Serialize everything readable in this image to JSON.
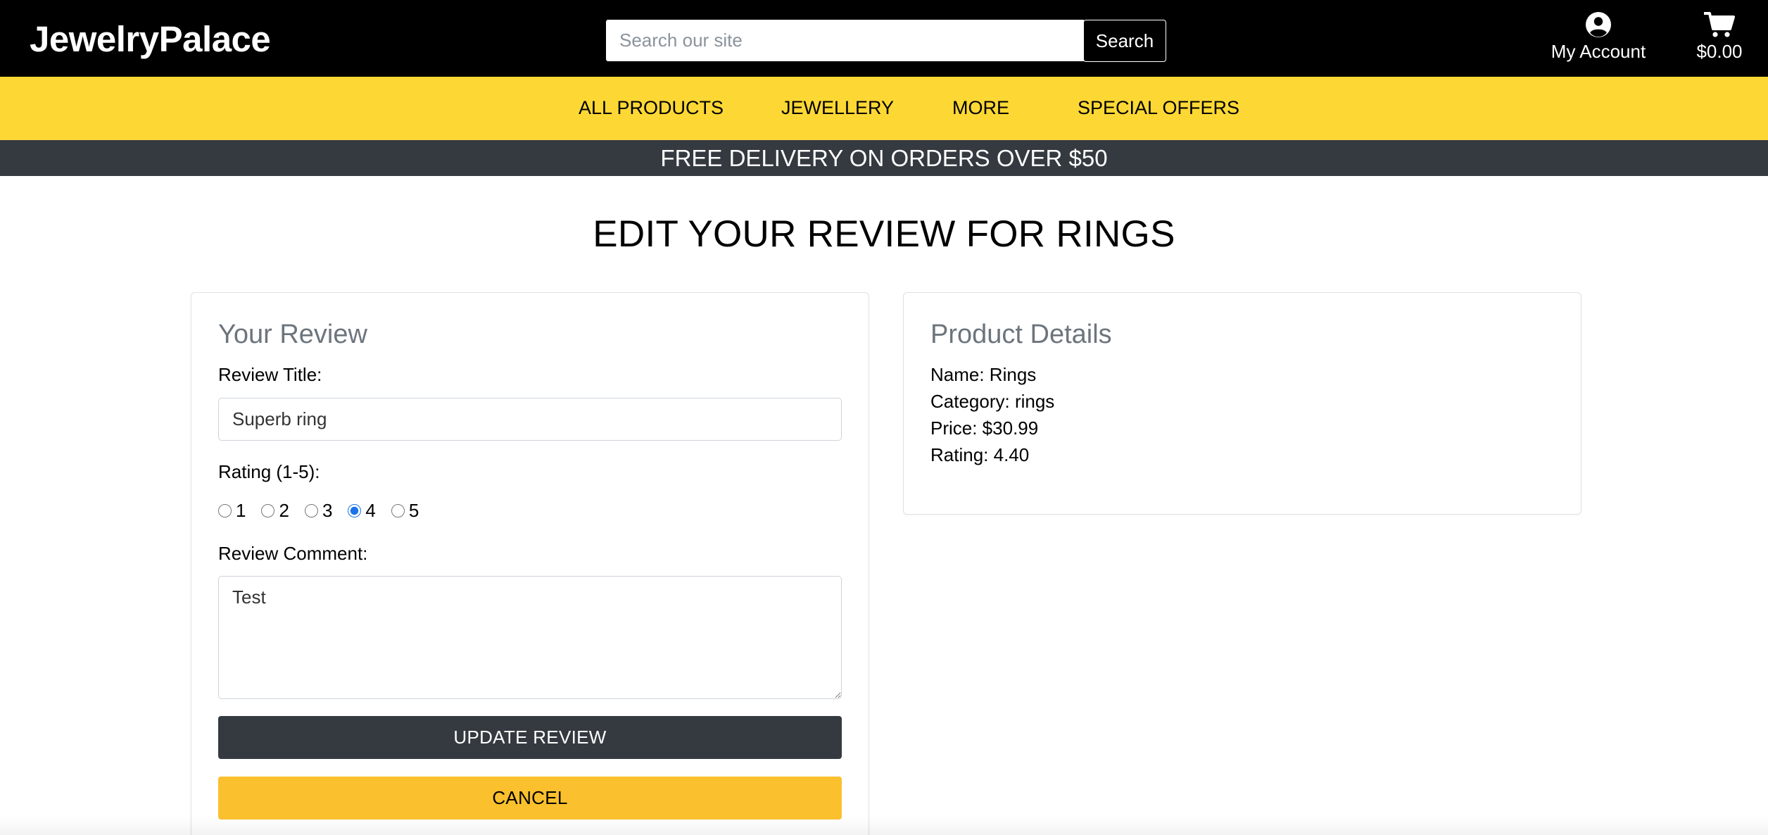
{
  "header": {
    "logo": "JewelryPalace",
    "search_placeholder": "Search our site",
    "search_button": "Search",
    "account_label": "My Account",
    "account_icon": "user-circle-icon",
    "cart_total": "$0.00",
    "cart_icon": "shopping-cart-icon"
  },
  "nav": {
    "items": [
      {
        "label": "ALL PRODUCTS"
      },
      {
        "label": "JEWELLERY"
      },
      {
        "label": "MORE"
      },
      {
        "label": "SPECIAL OFFERS"
      }
    ]
  },
  "banner": {
    "text": "FREE DELIVERY ON ORDERS OVER $50"
  },
  "page": {
    "title": "EDIT YOUR REVIEW FOR RINGS"
  },
  "review_form": {
    "heading": "Your Review",
    "title_label": "Review Title:",
    "title_value": "Superb ring",
    "rating_label": "Rating (1-5):",
    "rating_options": [
      "1",
      "2",
      "3",
      "4",
      "5"
    ],
    "rating_selected": "4",
    "comment_label": "Review Comment:",
    "comment_value": "Test",
    "update_button": "UPDATE REVIEW",
    "cancel_button": "CANCEL"
  },
  "product_details": {
    "heading": "Product Details",
    "name_line": "Name: Rings",
    "category_line": "Category: rings",
    "price_line": "Price: $30.99",
    "rating_line": "Rating: 4.40"
  },
  "colors": {
    "header_bg": "#000000",
    "nav_bg": "#fdd835",
    "banner_bg": "#343a40",
    "update_button_bg": "#343a40",
    "cancel_button_bg": "#fbc02d",
    "heading_gray": "#6c757d"
  }
}
